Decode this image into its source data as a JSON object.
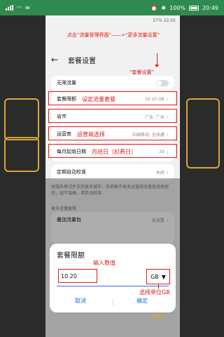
{
  "outer_status": {
    "right_text": "100%",
    "time": "20:49"
  },
  "inner_status": {
    "left_text": "",
    "right_text": "57% 22:02"
  },
  "annotations": {
    "top": "点击“流量管理界面”——>“更多流量设置”",
    "settings": "“套餐设置”",
    "set_package": "设定流量套餐",
    "carrier_select": "运营商选择",
    "month_start": "月结日（扣费日）",
    "input_value": "输入数值",
    "select_unit": "选择单位GB"
  },
  "nav": {
    "title": "套餐设置"
  },
  "rows": {
    "unlimited": "无限流量",
    "package_limit": {
      "label": "套餐限额",
      "value": "10.20 GB"
    },
    "province": {
      "label": "省市",
      "value": "广东: 广州"
    },
    "carrier": {
      "label": "运营商",
      "value": "中国移动: 全球通"
    },
    "month_start": {
      "label": "每月起始日期",
      "value": "29"
    },
    "auto_calibrate": {
      "label": "定期自动校准",
      "value": "关闭"
    },
    "stacked": {
      "label": "叠加流量包",
      "value": "未设置"
    }
  },
  "description": "本服务将试步支持更多城市，且依赖于收发运营商流量查询发短信，如不准确，请手动校准",
  "section_more": "更多流量套餐",
  "dialog": {
    "title": "套餐限额",
    "input_value": "10.20",
    "unit": "GB",
    "cancel": "取消",
    "confirm": "确定"
  },
  "close_label": "关闭",
  "colors": {
    "accent_blue": "#1a73e8",
    "annotation_red": "#e01919",
    "status_green": "#2f8a4e",
    "close_orange": "#e8a31d"
  }
}
